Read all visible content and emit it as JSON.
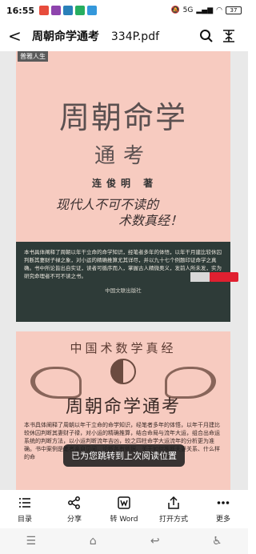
{
  "status": {
    "time": "16:55",
    "net": "5G",
    "battery": "37"
  },
  "topbar": {
    "title": "周朝命学通考",
    "filename": "334P.pdf"
  },
  "page1": {
    "tag": "普雅人生",
    "title": "周朝命学",
    "subtitle": "通考",
    "author": "连俊明 著",
    "slogan_line1": "现代人不可不读的",
    "slogan_line2": "术数真经！",
    "blurb": "本书具体阐释了周朝以年干立命的命学知识，经笔者多年的体悟，以年干月建比较休囚判断其妻财子禄之象，对小运的精确推算尤其详尽，并以九十七个例题印证命学之真确。书中所论皆出自实证，读者可循序而入，掌握古人精微奥义，发前人所未发，实为研究命理者不可不读之书。",
    "publisher": "中国文联出版社"
  },
  "page2": {
    "header": "中国术数学真经",
    "title": "周朝命学通考",
    "body": "本书具体阐释了周朝以年干立命的命学知识，经笔者多年的体悟，以年干月建比较休囚判断其妻财子禄，对小运的精确推算，结合命局与流年大运，组合出命运系统的判断方法，以小运判断流年吉凶，较之四柱命学大运流年的分析更为准确。书中案例是笔者亲自见闻，论断各有依据，关于如何推断夫妻关系、什么样的命"
  },
  "toast": "已为您跳转到上次阅读位置",
  "toolbar": [
    {
      "label": "目录",
      "icon": "list-icon"
    },
    {
      "label": "分享",
      "icon": "share-icon"
    },
    {
      "label": "转 Word",
      "icon": "word-icon"
    },
    {
      "label": "打开方式",
      "icon": "open-with-icon"
    },
    {
      "label": "更多",
      "icon": "more-icon"
    }
  ],
  "colors": {
    "page_bg": "#f7cbc0",
    "band": "#2e3b38",
    "title_text": "#5b5050"
  }
}
